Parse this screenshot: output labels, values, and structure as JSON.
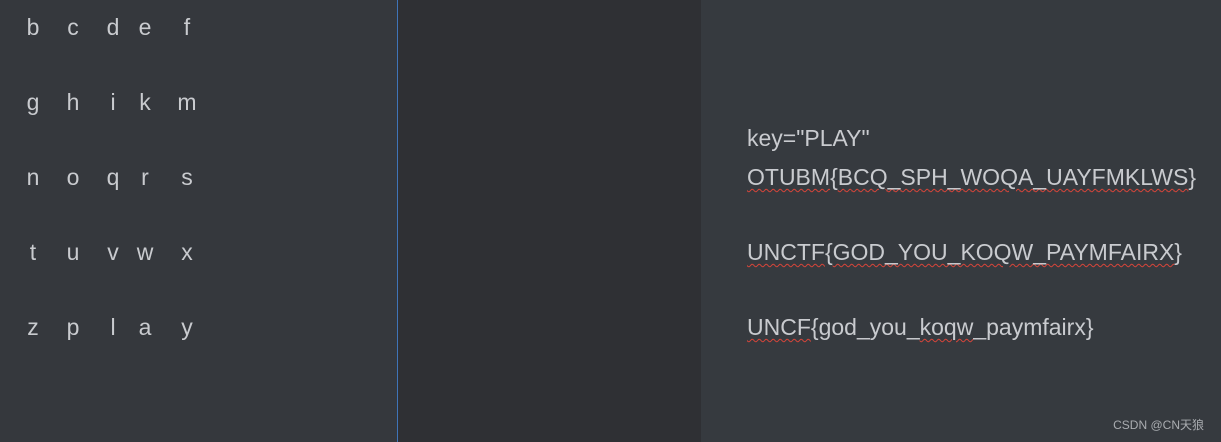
{
  "letter_grid": {
    "rows": [
      [
        "b",
        "c",
        "d",
        "e",
        "f"
      ],
      [
        "g",
        "h",
        "i",
        "k",
        "m"
      ],
      [
        "n",
        "o",
        "q",
        "r",
        "s"
      ],
      [
        "t",
        "u",
        "v",
        "w",
        "x"
      ],
      [
        "z",
        "p",
        "l",
        "a",
        "y"
      ]
    ]
  },
  "notes": {
    "key": "key=\"PLAY\"",
    "cipher": {
      "prefix": "OTUBM",
      "brace_open": "{",
      "body": "BCQ_SPH_WOQA_UAYFMKLWS",
      "brace_close": "}"
    },
    "flag": {
      "prefix": "UNCTF",
      "brace_open": "{",
      "body": "GOD_YOU_KOQW_PAYMFAIRX",
      "brace_close": "}"
    },
    "alt": {
      "prefix": "UNCF",
      "brace_open": "{",
      "part1": "god_you_",
      "part2": "koqw",
      "part3": "_paymfairx",
      "brace_close": "}"
    }
  },
  "watermark": "CSDN @CN天狼",
  "colors": {
    "spellcheck_underline": "#d8453a",
    "divider": "#3f74b8"
  }
}
